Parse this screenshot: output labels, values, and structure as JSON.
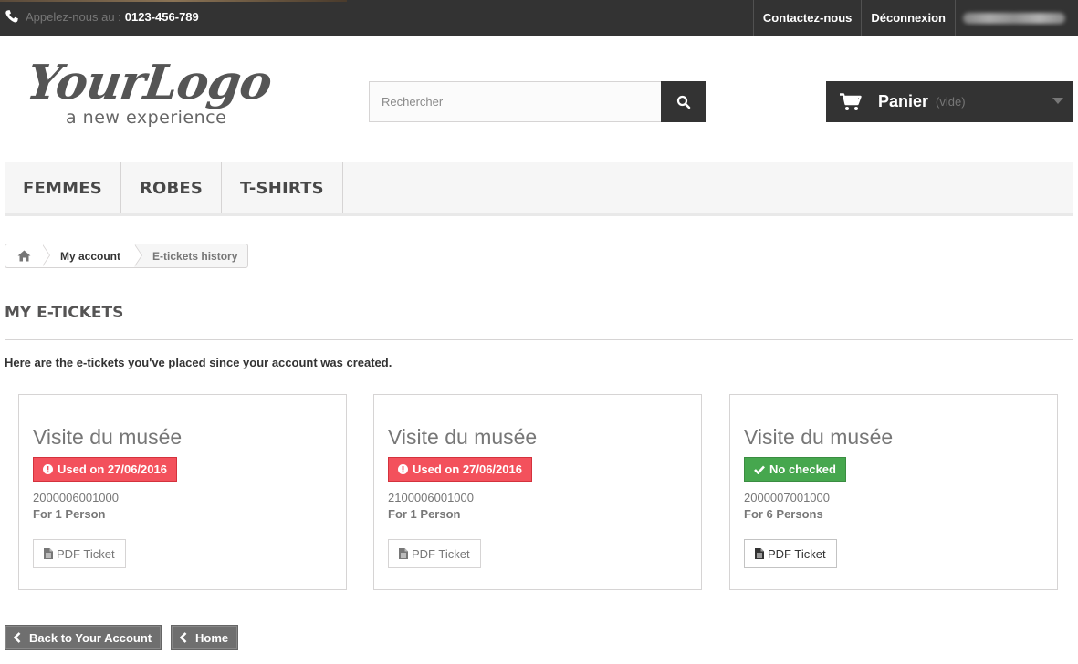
{
  "topbar": {
    "phone_prefix": "Appelez-nous au :",
    "phone_number": "0123-456-789",
    "links": [
      "Contactez-nous",
      "Déconnexion"
    ]
  },
  "header": {
    "logo_main": "YourLogo",
    "logo_sub": "a new experience",
    "search_placeholder": "Rechercher",
    "cart_label": "Panier",
    "cart_status": "(vide)"
  },
  "menu": {
    "items": [
      "FEMMES",
      "ROBES",
      "T-SHIRTS"
    ]
  },
  "breadcrumb": {
    "account": "My account",
    "current": "E-tickets history"
  },
  "page": {
    "heading": "MY E-TICKETS",
    "intro": "Here are the e-tickets you've placed since your account was created."
  },
  "tickets": [
    {
      "title": "Visite du musée",
      "status": "Used on 27/06/2016",
      "status_type": "used",
      "code": "2000006001000",
      "persons": "For 1 Person",
      "pdf_label": "PDF Ticket"
    },
    {
      "title": "Visite du musée",
      "status": "Used on 27/06/2016",
      "status_type": "used",
      "code": "2100006001000",
      "persons": "For 1 Person",
      "pdf_label": "PDF Ticket"
    },
    {
      "title": "Visite du musée",
      "status": "No checked",
      "status_type": "ok",
      "code": "2000007001000",
      "persons": "For 6 Persons",
      "pdf_label": "PDF Ticket"
    }
  ],
  "footer_nav": {
    "back_label": "Back to Your Account",
    "home_label": "Home"
  },
  "colors": {
    "used": "#f3515c",
    "ok": "#46a74e",
    "dark": "#333333"
  }
}
